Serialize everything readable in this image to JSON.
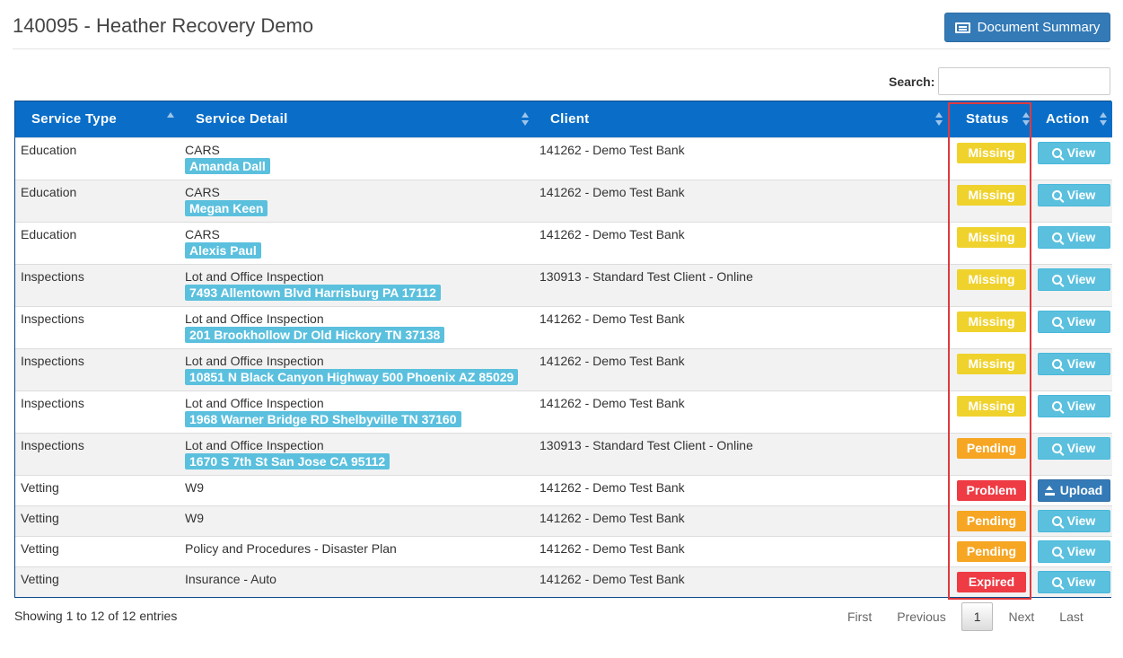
{
  "header": {
    "title": "140095 - Heather Recovery Demo",
    "summary_button": "Document Summary"
  },
  "search": {
    "label": "Search:",
    "value": ""
  },
  "table": {
    "columns": [
      "Service Type",
      "Service Detail",
      "Client",
      "Status",
      "Action"
    ],
    "rows": [
      {
        "type": "Education",
        "detail": "CARS",
        "tag": "Amanda Dall",
        "client": "141262 - Demo Test Bank",
        "status": "Missing",
        "action": "View"
      },
      {
        "type": "Education",
        "detail": "CARS",
        "tag": "Megan Keen",
        "client": "141262 - Demo Test Bank",
        "status": "Missing",
        "action": "View"
      },
      {
        "type": "Education",
        "detail": "CARS",
        "tag": "Alexis Paul",
        "client": "141262 - Demo Test Bank",
        "status": "Missing",
        "action": "View"
      },
      {
        "type": "Inspections",
        "detail": "Lot and Office Inspection",
        "tag": "7493 Allentown Blvd Harrisburg PA 17112",
        "client": "130913 - Standard Test Client - Online",
        "status": "Missing",
        "action": "View"
      },
      {
        "type": "Inspections",
        "detail": "Lot and Office Inspection",
        "tag": "201 Brookhollow Dr Old Hickory TN 37138",
        "client": "141262 - Demo Test Bank",
        "status": "Missing",
        "action": "View"
      },
      {
        "type": "Inspections",
        "detail": "Lot and Office Inspection",
        "tag": "10851 N Black Canyon Highway 500 Phoenix AZ 85029",
        "client": "141262 - Demo Test Bank",
        "status": "Missing",
        "action": "View"
      },
      {
        "type": "Inspections",
        "detail": "Lot and Office Inspection",
        "tag": "1968 Warner Bridge RD Shelbyville TN 37160",
        "client": "141262 - Demo Test Bank",
        "status": "Missing",
        "action": "View"
      },
      {
        "type": "Inspections",
        "detail": "Lot and Office Inspection",
        "tag": "1670 S 7th St San Jose CA 95112",
        "client": "130913 - Standard Test Client - Online",
        "status": "Pending",
        "action": "View"
      },
      {
        "type": "Vetting",
        "detail": "W9",
        "tag": "",
        "client": "141262 - Demo Test Bank",
        "status": "Problem",
        "action": "Upload"
      },
      {
        "type": "Vetting",
        "detail": "W9",
        "tag": "",
        "client": "141262 - Demo Test Bank",
        "status": "Pending",
        "action": "View"
      },
      {
        "type": "Vetting",
        "detail": "Policy and Procedures - Disaster Plan",
        "tag": "",
        "client": "141262 - Demo Test Bank",
        "status": "Pending",
        "action": "View"
      },
      {
        "type": "Vetting",
        "detail": "Insurance - Auto",
        "tag": "",
        "client": "141262 - Demo Test Bank",
        "status": "Expired",
        "action": "View"
      }
    ]
  },
  "footer": {
    "info": "Showing 1 to 12 of 12 entries",
    "pagination": {
      "first": "First",
      "previous": "Previous",
      "current": "1",
      "next": "Next",
      "last": "Last"
    }
  },
  "colors": {
    "header_blue": "#0a6ec8",
    "tag_cyan": "#5bc0de",
    "missing": "#f0d22d",
    "pending": "#f6a623",
    "problem": "#ee3b44",
    "highlight": "#e0393e"
  }
}
